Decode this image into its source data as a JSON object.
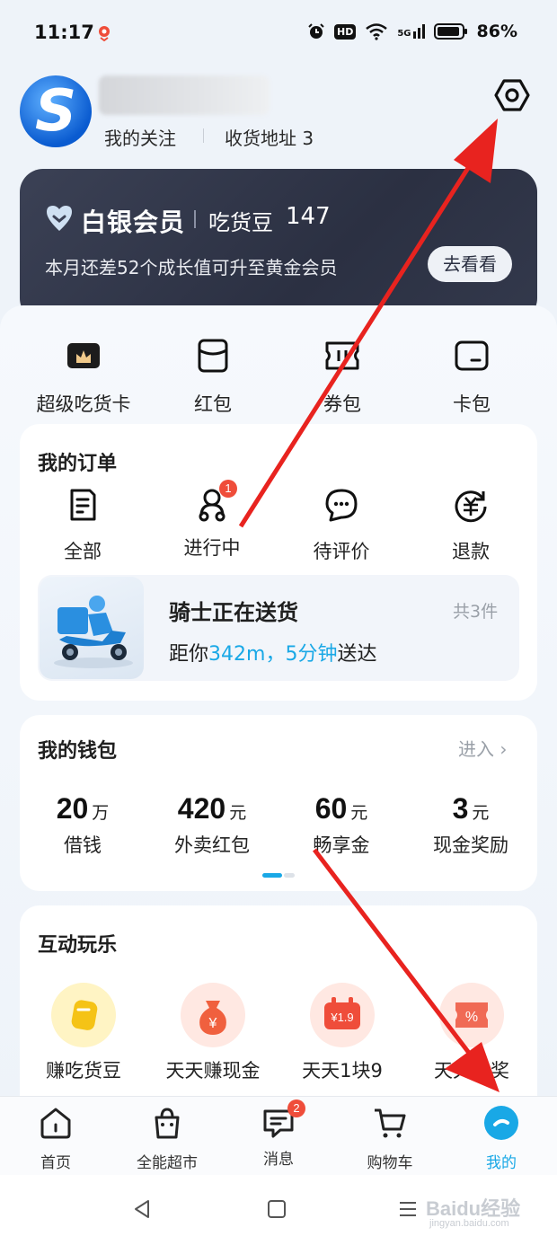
{
  "status_bar": {
    "time": "11:17",
    "battery": "86%",
    "network": "5G",
    "hd": "HD"
  },
  "profile": {
    "following": "我的关注",
    "address": "收货地址 3"
  },
  "member": {
    "title": "白银会员",
    "beans_label": "吃货豆",
    "beans_count": "147",
    "description": "本月还差52个成长值可升至黄金会员",
    "button": "去看看"
  },
  "quick_links": [
    {
      "label": "超级吃货卡",
      "icon": "crown-card-icon"
    },
    {
      "label": "红包",
      "icon": "red-packet-icon"
    },
    {
      "label": "券包",
      "icon": "coupon-icon"
    },
    {
      "label": "卡包",
      "icon": "card-wallet-icon"
    }
  ],
  "orders": {
    "title": "我的订单",
    "items": [
      {
        "label": "全部",
        "icon": "order-list-icon"
      },
      {
        "label": "进行中",
        "icon": "rider-icon",
        "badge": "1"
      },
      {
        "label": "待评价",
        "icon": "comment-icon"
      },
      {
        "label": "退款",
        "icon": "refund-icon"
      }
    ],
    "delivery": {
      "title": "骑士正在送货",
      "count": "共3件",
      "eta_prefix": "距你",
      "distance": "342m",
      "comma": "，",
      "minutes": "5分钟",
      "eta_suffix": "送达"
    }
  },
  "wallet": {
    "title": "我的钱包",
    "enter": "进入",
    "items": [
      {
        "value": "20",
        "unit": "万",
        "label": "借钱"
      },
      {
        "value": "420",
        "unit": "元",
        "label": "外卖红包"
      },
      {
        "value": "60",
        "unit": "元",
        "label": "畅享金"
      },
      {
        "value": "3",
        "unit": "元",
        "label": "现金奖励"
      }
    ]
  },
  "fun": {
    "title": "互动玩乐",
    "items": [
      {
        "label": "赚吃货豆",
        "icon": "bean-icon"
      },
      {
        "label": "天天赚现金",
        "icon": "money-bag-icon"
      },
      {
        "label": "天天1块9",
        "icon": "price-tag-icon"
      },
      {
        "label": "天天抽奖",
        "icon": "lottery-icon"
      }
    ],
    "price_tag_text": "¥1.9"
  },
  "tabs": [
    {
      "label": "首页",
      "icon": "home-icon"
    },
    {
      "label": "全能超市",
      "icon": "shopping-bag-icon"
    },
    {
      "label": "消息",
      "icon": "message-icon",
      "badge": "2"
    },
    {
      "label": "购物车",
      "icon": "cart-icon"
    },
    {
      "label": "我的",
      "icon": "profile-icon",
      "active": true
    }
  ],
  "watermark": {
    "text": "Baidu经验",
    "sub": "jingyan.baidu.com"
  },
  "colors": {
    "accent": "#19a8e6",
    "badge_red": "#ef4d3a",
    "member_card": "#2b3042",
    "arrow_red": "#e8231f"
  }
}
